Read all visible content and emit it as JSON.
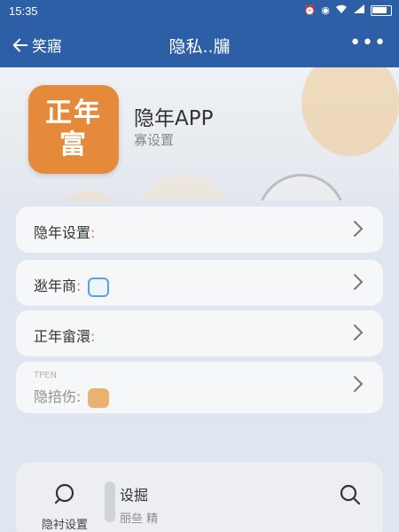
{
  "status_bar": {
    "time": "15:35",
    "icons": [
      "alarm-icon",
      "eye-icon",
      "wifi-icon",
      "signal-icon",
      "battery-icon"
    ]
  },
  "nav": {
    "back_label": "笑寤",
    "title": "隐私..牖",
    "more_label": "•••"
  },
  "app": {
    "icon_line1": "正年",
    "icon_line2": "富",
    "name": "隐年APP",
    "subtitle": "寡设置"
  },
  "menu": {
    "items": [
      {
        "label": "隐年设置",
        "colon": ":",
        "icon": ""
      },
      {
        "label": "逖年商",
        "colon": ":",
        "icon": "qr-icon"
      },
      {
        "label": "正年畲澴",
        "colon": ":",
        "icon": ""
      },
      {
        "label": "隐掊伤",
        "colon": ":",
        "icon": "app-thumb-icon",
        "tiny": "TPEN"
      }
    ]
  },
  "bottom": {
    "left_label": "隐衬设置",
    "title": "设掘",
    "subtitle": "丽亝 精"
  },
  "colors": {
    "primary": "#2d5fa6",
    "accent": "#e5893a",
    "card_bg": "#f6f7f9"
  }
}
